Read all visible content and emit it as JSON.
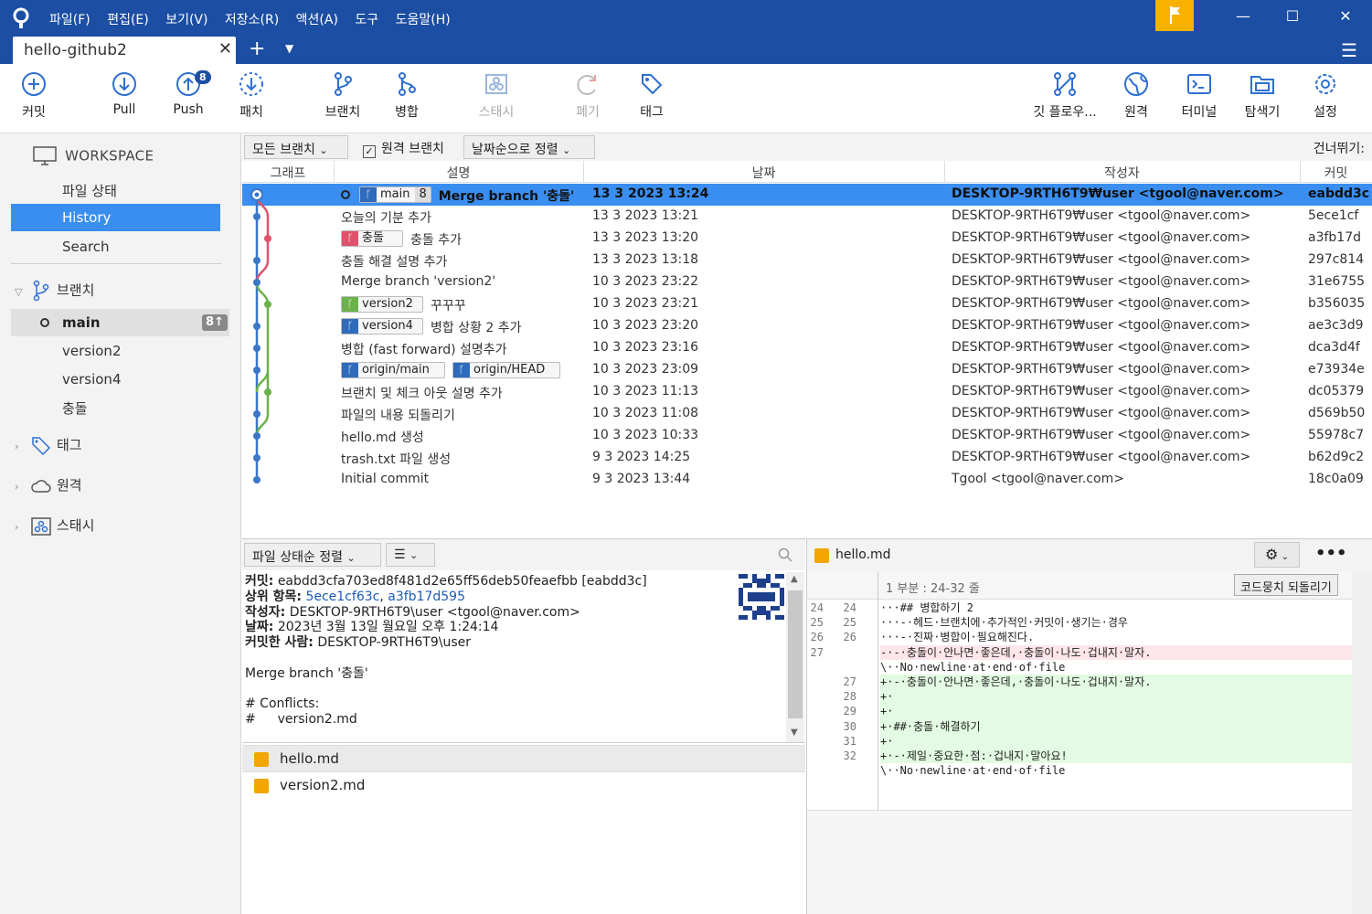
{
  "menu": [
    "파일(F)",
    "편집(E)",
    "보기(V)",
    "저장소(R)",
    "액션(A)",
    "도구",
    "도움말(H)"
  ],
  "tab": {
    "title": "hello-github2"
  },
  "toolbar": {
    "commit": "커밋",
    "pull": "Pull",
    "push": "Push",
    "push_badge": "8",
    "fetch": "패치",
    "branch": "브랜치",
    "merge": "병합",
    "stash": "스태시",
    "discard": "폐기",
    "tag": "태그",
    "gitflow": "깃 플로우...",
    "remote": "원격",
    "terminal": "터미널",
    "explorer": "탐색기",
    "settings": "설정"
  },
  "sidebar": {
    "workspace": "WORKSPACE",
    "file_status": "파일 상태",
    "history": "History",
    "search": "Search",
    "branches": "브랜치",
    "main": "main",
    "main_count": "8↑",
    "branch_items": [
      "version2",
      "version4",
      "충돌"
    ],
    "tags": "태그",
    "remotes": "원격",
    "stashes": "스태시"
  },
  "filter": {
    "all_branches": "모든 브랜치",
    "remote_branches": "원격 브랜치",
    "sort": "날짜순으로 정렬",
    "skip": "건너뛰기:"
  },
  "columns": {
    "graph": "그래프",
    "desc": "설명",
    "date": "날짜",
    "author": "작성자",
    "commit": "커밋"
  },
  "commits": [
    {
      "tag1": "main",
      "tag1n": "8",
      "desc": "Merge branch '충돌'",
      "date": "13 3 2023 13:24",
      "author": "DESKTOP-9RTH6T9₩user <tgool@naver.com>",
      "hash": "eabdd3c"
    },
    {
      "desc": "오늘의 기분 추가",
      "date": "13 3 2023 13:21",
      "author": "DESKTOP-9RTH6T9₩user <tgool@naver.com>",
      "hash": "5ece1cf"
    },
    {
      "tag1": "충돌",
      "desc": "충돌 추가",
      "date": "13 3 2023 13:20",
      "author": "DESKTOP-9RTH6T9₩user <tgool@naver.com>",
      "hash": "a3fb17d"
    },
    {
      "desc": "충돌 해결 설명 추가",
      "date": "13 3 2023 13:18",
      "author": "DESKTOP-9RTH6T9₩user <tgool@naver.com>",
      "hash": "297c814"
    },
    {
      "desc": "Merge branch 'version2'",
      "date": "10 3 2023 23:22",
      "author": "DESKTOP-9RTH6T9₩user <tgool@naver.com>",
      "hash": "31e6755"
    },
    {
      "tag1": "version2",
      "desc": "꾸꾸꾸",
      "date": "10 3 2023 23:21",
      "author": "DESKTOP-9RTH6T9₩user <tgool@naver.com>",
      "hash": "b356035"
    },
    {
      "tag1": "version4",
      "desc": "병합 상황 2 추가",
      "date": "10 3 2023 23:20",
      "author": "DESKTOP-9RTH6T9₩user <tgool@naver.com>",
      "hash": "ae3c3d9"
    },
    {
      "desc": "병합 (fast forward) 설명추가",
      "date": "10 3 2023 23:16",
      "author": "DESKTOP-9RTH6T9₩user <tgool@naver.com>",
      "hash": "dca3d4f"
    },
    {
      "tag1": "origin/main",
      "tag2": "origin/HEAD",
      "desc": "",
      "date": "10 3 2023 23:09",
      "author": "DESKTOP-9RTH6T9₩user <tgool@naver.com>",
      "hash": "e73934e"
    },
    {
      "desc": "브랜치 및 체크 아웃 설명 추가",
      "date": "10 3 2023 11:13",
      "author": "DESKTOP-9RTH6T9₩user <tgool@naver.com>",
      "hash": "dc05379"
    },
    {
      "desc": "파일의 내용 되돌리기",
      "date": "10 3 2023 11:08",
      "author": "DESKTOP-9RTH6T9₩user <tgool@naver.com>",
      "hash": "d569b50"
    },
    {
      "desc": "hello.md 생성",
      "date": "10 3 2023 10:33",
      "author": "DESKTOP-9RTH6T9₩user <tgool@naver.com>",
      "hash": "55978c7"
    },
    {
      "desc": "trash.txt 파일 생성",
      "date": "9 3 2023 14:25",
      "author": "DESKTOP-9RTH6T9₩user <tgool@naver.com>",
      "hash": "b62d9c2"
    },
    {
      "desc": "Initial commit",
      "date": "9 3 2023 13:44",
      "author": "Tgool <tgool@naver.com>",
      "hash": "18c0a09"
    }
  ],
  "details": {
    "sort": "파일 상태순 정렬",
    "commit_label": "커밋:",
    "commit_value": "eabdd3cfa703ed8f481d2e65ff56deb50feaefbb [eabdd3c]",
    "parents_label": "상위 항목:",
    "parent1": "5ece1cf63c",
    "parent2": "a3fb17d595",
    "author_label": "작성자:",
    "author_value": "DESKTOP-9RTH6T9\\user <tgool@naver.com>",
    "date_label": "날짜:",
    "date_value": "2023년 3월 13일 월요일 오후 1:24:14",
    "committer_label": "커밋한 사람:",
    "committer_value": "DESKTOP-9RTH6T9\\user",
    "message": "Merge branch '충돌'\n\n# Conflicts:\n#\tversion2.md",
    "files": [
      "hello.md",
      "version2.md"
    ]
  },
  "diff": {
    "file": "hello.md",
    "hunk": "1 부분 : 24-32 줄",
    "revert": "코드뭉치 되돌리기",
    "lines": [
      {
        "a": "24",
        "b": "24",
        "t": "···## 병합하기 2",
        "k": "ctx"
      },
      {
        "a": "25",
        "b": "25",
        "t": "···-·헤드·브랜치에·추가적인·커밋이·생기는·경우",
        "k": "ctx"
      },
      {
        "a": "26",
        "b": "26",
        "t": "···-·진짜·병합이·필요해진다.",
        "k": "ctx"
      },
      {
        "a": "27",
        "b": "",
        "t": "-·-·충돌이·안나면·좋은데,·충돌이·나도·겁내지·말자.",
        "k": "del"
      },
      {
        "a": "",
        "b": "",
        "t": "\\··No·newline·at·end·of·file",
        "k": "ctx"
      },
      {
        "a": "",
        "b": "27",
        "t": "+·-·충돌이·안나면·좋은데,·충돌이·나도·겁내지·말자.",
        "k": "add"
      },
      {
        "a": "",
        "b": "28",
        "t": "+·",
        "k": "add"
      },
      {
        "a": "",
        "b": "29",
        "t": "+·",
        "k": "add"
      },
      {
        "a": "",
        "b": "30",
        "t": "+·##·충돌·해결하기",
        "k": "add"
      },
      {
        "a": "",
        "b": "31",
        "t": "+·",
        "k": "add"
      },
      {
        "a": "",
        "b": "32",
        "t": "+·-·제일·중요한·점:·겁내지·말아요!",
        "k": "add"
      },
      {
        "a": "",
        "b": "",
        "t": "\\··No·newline·at·end·of·file",
        "k": "ctx"
      }
    ]
  },
  "colors": {
    "titlebar": "#1c4ea3",
    "selection": "#3a8ef0",
    "flag": "#f9b100",
    "line_main": "#3b77c8",
    "line_red": "#e0526b",
    "line_green": "#6bb24a"
  }
}
